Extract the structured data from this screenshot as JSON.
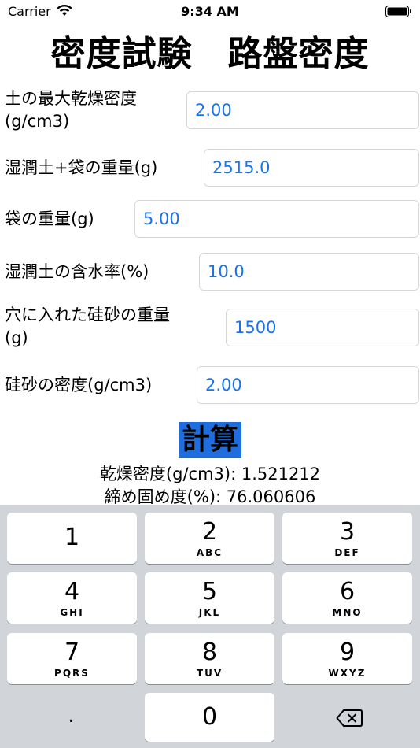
{
  "status_bar": {
    "carrier": "Carrier",
    "time": "9:34 AM",
    "wifi": "wifi-icon",
    "battery": "battery-full-icon"
  },
  "title": "密度試験　路盤密度",
  "fields": [
    {
      "label_line1": "土の最大乾燥密度",
      "label_line2": "(g/cm3)",
      "value": "2.00"
    },
    {
      "label_line1": "湿潤土+袋の重量(g)",
      "label_line2": "",
      "value": "2515.0"
    },
    {
      "label_line1": "袋の重量(g)",
      "label_line2": "",
      "value": "5.00"
    },
    {
      "label_line1": "湿潤土の含水率(%)",
      "label_line2": "",
      "value": "10.0"
    },
    {
      "label_line1": "穴に入れた硅砂の重量",
      "label_line2": "(g)",
      "value": "1500"
    },
    {
      "label_line1": "硅砂の密度(g/cm3)",
      "label_line2": "",
      "value": "2.00"
    }
  ],
  "calculate_label": "計算",
  "results": {
    "dry_density": "乾燥密度(g/cm3): 1.521212",
    "compaction": "締め固め度(%): 76.060606"
  },
  "keyboard": {
    "keys": [
      {
        "digit": "1",
        "letters": ""
      },
      {
        "digit": "2",
        "letters": "ABC"
      },
      {
        "digit": "3",
        "letters": "DEF"
      },
      {
        "digit": "4",
        "letters": "GHI"
      },
      {
        "digit": "5",
        "letters": "JKL"
      },
      {
        "digit": "6",
        "letters": "MNO"
      },
      {
        "digit": "7",
        "letters": "PQRS"
      },
      {
        "digit": "8",
        "letters": "TUV"
      },
      {
        "digit": "9",
        "letters": "WXYZ"
      },
      {
        "digit": "0",
        "letters": ""
      }
    ],
    "dot_label": ".",
    "delete_icon": "delete-backward-icon"
  },
  "colors": {
    "accent": "#1e6ee0",
    "field_text": "#1a73e8",
    "keyboard_bg": "#d1d4d9"
  }
}
